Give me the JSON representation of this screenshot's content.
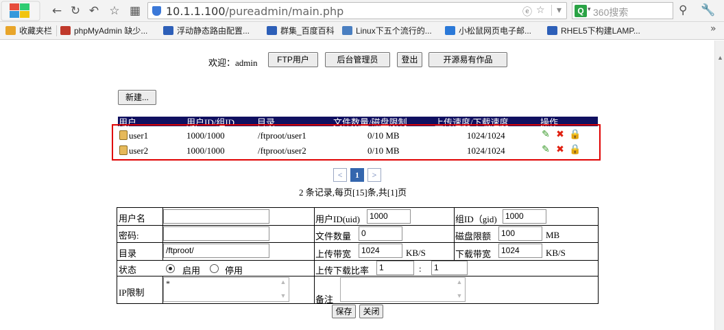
{
  "browser": {
    "url_host": "10.1.1.100",
    "url_path": "/pureadmin/main.php",
    "search_placeholder": "360搜索",
    "bookmarks": [
      {
        "label": "收藏夹栏",
        "color": "#e8a52a"
      },
      {
        "label": "phpMyAdmin 缺少...",
        "color": "#c0392b"
      },
      {
        "label": "浮动静态路由配置...",
        "color": "#2d5fb8"
      },
      {
        "label": "群集_百度百科",
        "color": "#2d5fb8"
      },
      {
        "label": "Linux下五个流行的...",
        "color": "#4a7fc1"
      },
      {
        "label": "小松鼠网页电子邮...",
        "color": "#2b79d8"
      },
      {
        "label": "RHEL5下构建LAMP...",
        "color": "#2d5fb8"
      }
    ]
  },
  "header": {
    "welcome": "欢迎：admin",
    "nav": [
      "FTP用户",
      "后台管理员",
      "登出",
      "开源易有作品"
    ]
  },
  "new_button": "新建...",
  "table": {
    "columns": [
      "用户",
      "用户ID/组ID",
      "目录",
      "文件数量/磁盘限制",
      "上传速度/下载速度",
      "操作"
    ],
    "rows": [
      {
        "user": "user1",
        "ids": "1000/1000",
        "dir": "/ftproot/user1",
        "quota": "0/10 MB",
        "speed": "1024/1024"
      },
      {
        "user": "user2",
        "ids": "1000/1000",
        "dir": "/ftproot/user2",
        "quota": "0/10 MB",
        "speed": "1024/1024"
      }
    ]
  },
  "pager": {
    "prev": "<",
    "current": "1",
    "next": ">",
    "summary": "2 条记录,每页[15]条,共[1]页"
  },
  "form": {
    "username_label": "用户名",
    "username_value": "",
    "uid_label": "用户ID(uid)",
    "uid_value": "1000",
    "gid_label": "组ID（gid)",
    "gid_value": "1000",
    "password_label": "密码:",
    "password_value": "",
    "filecount_label": "文件数量",
    "filecount_value": "0",
    "quota_label": "磁盘限额",
    "quota_value": "100",
    "quota_unit": "MB",
    "dir_label": "目录",
    "dir_value": "/ftproot/",
    "upload_label": "上传带宽",
    "upload_value": "1024",
    "upload_unit": "KB/S",
    "download_label": "下载带宽",
    "download_value": "1024",
    "download_unit": "KB/S",
    "status_label": "状态",
    "status_enabled": "启用",
    "status_disabled": "停用",
    "ratio_label": "上传下载比率",
    "ratio_up": "1",
    "ratio_sep": ":",
    "ratio_down": "1",
    "ip_label": "IP限制",
    "ip_value": "*",
    "note_label": "备注",
    "note_value": "",
    "save": "保存",
    "close": "关闭"
  }
}
